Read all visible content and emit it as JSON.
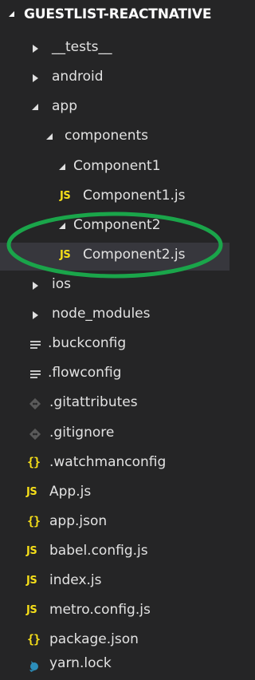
{
  "explorer": {
    "root_title": "GUESTLIST-REACTNATIVE",
    "items": [
      {
        "label": "__tests__",
        "type": "folder",
        "expanded": false
      },
      {
        "label": "android",
        "type": "folder",
        "expanded": false
      },
      {
        "label": "app",
        "type": "folder",
        "expanded": true
      },
      {
        "label": "components",
        "type": "folder",
        "expanded": true
      },
      {
        "label": "Component1",
        "type": "folder",
        "expanded": true
      },
      {
        "label": "Component1.js",
        "type": "file",
        "icon": "js-file-icon"
      },
      {
        "label": "Component2",
        "type": "folder",
        "expanded": true
      },
      {
        "label": "Component2.js",
        "type": "file",
        "icon": "js-file-icon",
        "selected": true
      },
      {
        "label": "ios",
        "type": "folder",
        "expanded": false
      },
      {
        "label": "node_modules",
        "type": "folder",
        "expanded": false
      },
      {
        "label": ".buckconfig",
        "type": "file",
        "icon": "config-file-icon"
      },
      {
        "label": ".flowconfig",
        "type": "file",
        "icon": "config-file-icon"
      },
      {
        "label": ".gitattributes",
        "type": "file",
        "icon": "git-file-icon"
      },
      {
        "label": ".gitignore",
        "type": "file",
        "icon": "git-file-icon"
      },
      {
        "label": ".watchmanconfig",
        "type": "file",
        "icon": "json-file-icon"
      },
      {
        "label": "App.js",
        "type": "file",
        "icon": "js-file-icon"
      },
      {
        "label": "app.json",
        "type": "file",
        "icon": "json-file-icon"
      },
      {
        "label": "babel.config.js",
        "type": "file",
        "icon": "js-file-icon"
      },
      {
        "label": "index.js",
        "type": "file",
        "icon": "js-file-icon"
      },
      {
        "label": "metro.config.js",
        "type": "file",
        "icon": "js-file-icon"
      },
      {
        "label": "package.json",
        "type": "file",
        "icon": "json-file-icon"
      },
      {
        "label": "yarn.lock",
        "type": "file",
        "icon": "yarn-file-icon"
      }
    ]
  },
  "colors": {
    "background": "#252526",
    "selected_row": "#37373d",
    "js_icon": "#f5de19",
    "annotation_circle": "#1aa54a"
  }
}
